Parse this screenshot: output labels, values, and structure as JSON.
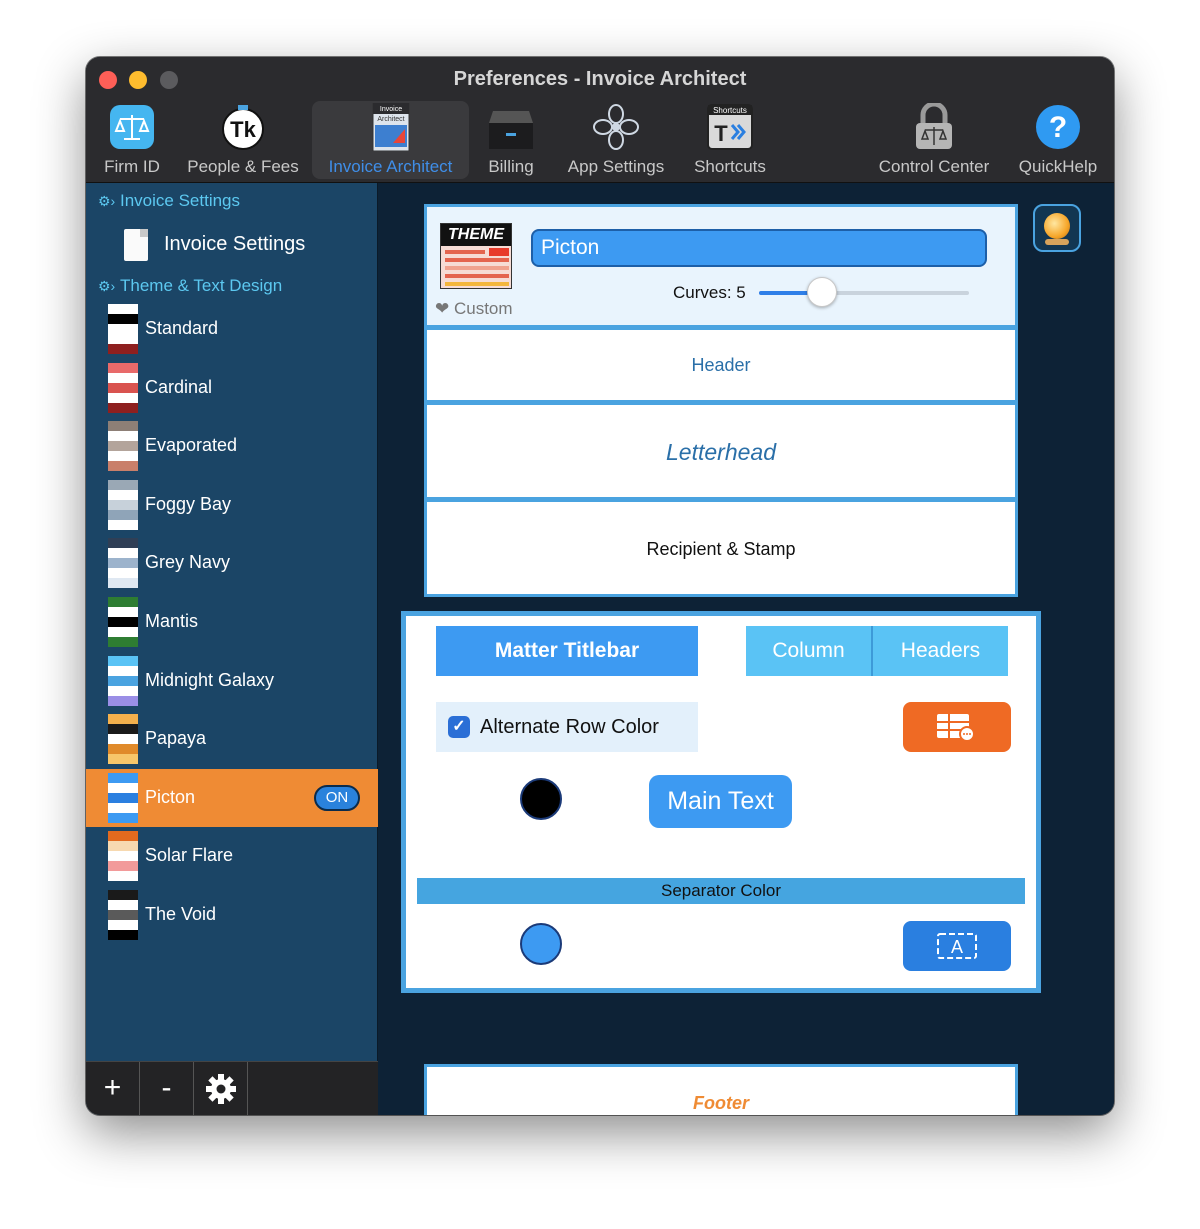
{
  "window": {
    "title": "Preferences - Invoice Architect"
  },
  "toolbar": [
    {
      "label": "Firm ID",
      "icon": "scales-icon"
    },
    {
      "label": "People & Fees",
      "icon": "tk-icon"
    },
    {
      "label": "Invoice Architect",
      "icon": "invoice-architect-icon",
      "active": true,
      "icon_text": [
        "Invoice",
        "Architect"
      ]
    },
    {
      "label": "Billing",
      "icon": "billing-drawer-icon"
    },
    {
      "label": "App Settings",
      "icon": "flower-icon"
    },
    {
      "label": "Shortcuts",
      "icon": "shortcuts-icon",
      "icon_text": [
        "Shortcuts"
      ]
    },
    {
      "label": "Control Center",
      "icon": "lock-icon"
    },
    {
      "label": "QuickHelp",
      "icon": "help-icon",
      "icon_text": [
        "?"
      ]
    }
  ],
  "sidebar": {
    "invoice_section": "Invoice Settings",
    "invoice_item": "Invoice Settings",
    "theme_section": "Theme & Text Design",
    "themes": [
      {
        "name": "Standard",
        "stripes": [
          "#ffffff",
          "#000000",
          "#ffffff",
          "#ffffff",
          "#8e1f1f"
        ]
      },
      {
        "name": "Cardinal",
        "stripes": [
          "#e86a6a",
          "#ffffff",
          "#d9534f",
          "#ffffff",
          "#8e1f1f"
        ]
      },
      {
        "name": "Evaporated",
        "stripes": [
          "#8d7f76",
          "#ffffff",
          "#b3a49b",
          "#ffffff",
          "#c97f6a"
        ]
      },
      {
        "name": "Foggy Bay",
        "stripes": [
          "#9aa8b5",
          "#ffffff",
          "#c7d1da",
          "#8fa4b8",
          "#ffffff"
        ]
      },
      {
        "name": "Grey Navy",
        "stripes": [
          "#2f3f56",
          "#ffffff",
          "#9cb3cc",
          "#ffffff",
          "#dfe8f2"
        ]
      },
      {
        "name": "Mantis",
        "stripes": [
          "#2e7d32",
          "#ffffff",
          "#000000",
          "#ffffff",
          "#2e7d32"
        ]
      },
      {
        "name": "Midnight Galaxy",
        "stripes": [
          "#5ac3f5",
          "#ffffff",
          "#4aa3e0",
          "#ffffff",
          "#9a8ee6"
        ]
      },
      {
        "name": "Papaya",
        "stripes": [
          "#f4b04c",
          "#1a1a1a",
          "#ffffff",
          "#e08a2a",
          "#f7c66a"
        ]
      },
      {
        "name": "Picton",
        "stripes": [
          "#3d9af2",
          "#ffffff",
          "#2a7fe0",
          "#ffffff",
          "#3d9af2"
        ],
        "selected": true,
        "badge": "ON"
      },
      {
        "name": "Solar Flare",
        "stripes": [
          "#e36a1e",
          "#f7d9b0",
          "#ffffff",
          "#f29a9a",
          "#ffffff"
        ]
      },
      {
        "name": "The Void",
        "stripes": [
          "#1a1a1a",
          "#ffffff",
          "#5a5a5a",
          "#ffffff",
          "#000000"
        ]
      }
    ],
    "bottom_buttons": [
      "+",
      "-"
    ]
  },
  "theme_card": {
    "logo_text": "THEME",
    "name_value": "Picton",
    "curves_label": "Curves: 5",
    "curves_value": 5,
    "curves_fraction": 0.3,
    "custom_label": "❤ Custom"
  },
  "sections": {
    "header": "Header",
    "letterhead": "Letterhead",
    "recipient": "Recipient & Stamp",
    "footer": "Footer"
  },
  "table_panel": {
    "matter_titlebar": "Matter Titlebar",
    "column": "Column",
    "headers": "Headers",
    "alt_row_label": "Alternate Row Color",
    "alt_row_checked": true,
    "alt_row_color": "#000000",
    "main_text": "Main Text",
    "separator_label": "Separator Color",
    "separator_color": "#3d9af2",
    "text_box_glyph": "A"
  },
  "colors": {
    "accent": "#3d9af2",
    "selection": "#ef8b34",
    "sidebar": "#1b4566",
    "main_bg": "#0d2236",
    "header_text": "#2a6fa8",
    "footer_text": "#ef8b34"
  }
}
